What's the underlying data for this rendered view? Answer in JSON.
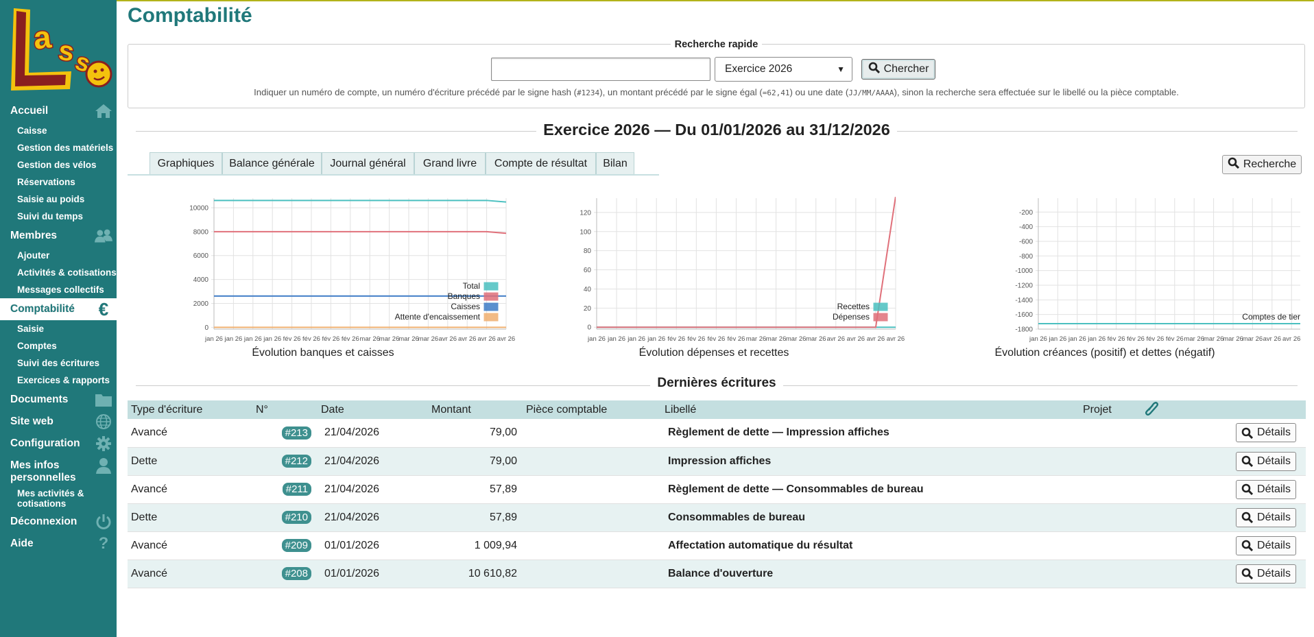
{
  "app": {
    "logo_text": "LASSO"
  },
  "sidebar": {
    "items": [
      {
        "label": "Accueil",
        "icon": "home-icon"
      },
      {
        "label": "Caisse"
      },
      {
        "label": "Gestion des matériels"
      },
      {
        "label": "Gestion des vélos"
      },
      {
        "label": "Réservations"
      },
      {
        "label": "Saisie au poids"
      },
      {
        "label": "Suivi du temps"
      },
      {
        "label": "Membres",
        "icon": "users-icon"
      },
      {
        "label": "Ajouter"
      },
      {
        "label": "Activités & cotisations"
      },
      {
        "label": "Messages collectifs"
      },
      {
        "label": "Comptabilité",
        "icon": "euro-icon",
        "active": true
      },
      {
        "label": "Saisie"
      },
      {
        "label": "Comptes"
      },
      {
        "label": "Suivi des écritures"
      },
      {
        "label": "Exercices & rapports"
      },
      {
        "label": "Documents",
        "icon": "folder-icon"
      },
      {
        "label": "Site web",
        "icon": "globe-icon"
      },
      {
        "label": "Configuration",
        "icon": "gear-icon"
      },
      {
        "label": "Mes infos personnelles",
        "icon": "user-icon"
      },
      {
        "label": "Mes activités & cotisations"
      },
      {
        "label": "Déconnexion",
        "icon": "power-icon"
      },
      {
        "label": "Aide",
        "icon": "question-icon"
      }
    ]
  },
  "page": {
    "title": "Comptabilité"
  },
  "quick_search": {
    "legend": "Recherche rapide",
    "input_value": "",
    "select_value": "Exercice 2026",
    "button_label": "Chercher",
    "help_parts": {
      "p1": "Indiquer un numéro de compte, un numéro d'écriture précédé par le signe hash (",
      "c1": "#1234",
      "p2": "), un montant précédé par le signe égal (",
      "c2": "=62,41",
      "p3": ") ou une date (",
      "c3": "JJ/MM/AAAA",
      "p4": "), sinon la recherche sera effectuée sur le libellé ou la pièce comptable."
    }
  },
  "exercise": {
    "title": "Exercice 2026 — Du 01/01/2026 au 31/12/2026"
  },
  "tabs": [
    {
      "label": "Graphiques"
    },
    {
      "label": "Balance générale"
    },
    {
      "label": "Journal général"
    },
    {
      "label": "Grand livre"
    },
    {
      "label": "Compte de résultat"
    },
    {
      "label": "Bilan"
    }
  ],
  "search_button": {
    "label": "Recherche"
  },
  "chart_data": [
    {
      "type": "line",
      "title": "Évolution banques et caisses",
      "x": [
        "jan 26",
        "jan 26",
        "jan 26",
        "jan 26",
        "fév 26",
        "fév 26",
        "fév 26",
        "fév 26",
        "mar 26",
        "mar 26",
        "mar 26",
        "mar 26",
        "avr 26",
        "avr 26",
        "avr 26",
        "avr 26"
      ],
      "yticks": [
        0,
        2000,
        4000,
        6000,
        8000,
        10000
      ],
      "ylim": [
        -150,
        10800
      ],
      "legend": "bottom-right",
      "grid": true,
      "series": [
        {
          "name": "Total",
          "color": "#4bc0c0",
          "values": [
            10610,
            10610,
            10610,
            10610,
            10610,
            10610,
            10610,
            10610,
            10610,
            10610,
            10610,
            10610,
            10610,
            10610,
            10610,
            10474
          ]
        },
        {
          "name": "Banques",
          "color": "#e0707a",
          "values": [
            7997,
            7997,
            7997,
            7997,
            7997,
            7997,
            7997,
            7997,
            7997,
            7997,
            7997,
            7997,
            7997,
            7997,
            7997,
            7861
          ]
        },
        {
          "name": "Caisses",
          "color": "#3e7cc6",
          "values": [
            2613,
            2613,
            2613,
            2613,
            2613,
            2613,
            2613,
            2613,
            2613,
            2613,
            2613,
            2613,
            2613,
            2613,
            2613,
            2613
          ]
        },
        {
          "name": "Attente d'encaissement",
          "color": "#f0b070",
          "values": [
            0,
            0,
            0,
            0,
            0,
            0,
            0,
            0,
            0,
            0,
            0,
            0,
            0,
            0,
            0,
            0
          ]
        }
      ]
    },
    {
      "type": "line",
      "title": "Évolution dépenses et recettes",
      "x": [
        "jan 26",
        "jan 26",
        "jan 26",
        "jan 26",
        "fév 26",
        "fév 26",
        "fév 26",
        "fév 26",
        "mar 26",
        "mar 26",
        "mar 26",
        "mar 26",
        "avr 26",
        "avr 26",
        "avr 26",
        "avr 26"
      ],
      "yticks": [
        0,
        20,
        40,
        60,
        80,
        100,
        120
      ],
      "ylim": [
        -2,
        135
      ],
      "legend": "bottom-right",
      "grid": true,
      "series": [
        {
          "name": "Recettes",
          "color": "#4bc0c0",
          "values": [
            0,
            0,
            0,
            0,
            0,
            0,
            0,
            0,
            0,
            0,
            0,
            0,
            0,
            0,
            0,
            0
          ]
        },
        {
          "name": "Dépenses",
          "color": "#e0707a",
          "values": [
            0,
            0,
            0,
            0,
            0,
            0,
            0,
            0,
            0,
            0,
            0,
            0,
            0,
            0,
            0,
            137
          ]
        }
      ]
    },
    {
      "type": "line",
      "title": "Évolution créances (positif) et dettes (négatif)",
      "x": [
        "jan 26",
        "jan 26",
        "jan 26",
        "jan 26",
        "fév 26",
        "fév 26",
        "fév 26",
        "fév 26",
        "mar 26",
        "mar 26",
        "mar 26",
        "mar 26",
        "avr 26",
        "avr 26",
        "avr 26",
        "avr 26"
      ],
      "yticks": [
        -1800,
        -1600,
        -1400,
        -1200,
        -1000,
        -800,
        -600,
        -400,
        -200
      ],
      "ylim": [
        -1800,
        -10
      ],
      "legend": "bottom-right",
      "grid": true,
      "series": [
        {
          "name": "Comptes de tiers",
          "color": "#4bc0c0",
          "values": [
            -1725,
            -1725,
            -1725,
            -1725,
            -1725,
            -1725,
            -1725,
            -1725,
            -1725,
            -1725,
            -1725,
            -1725,
            -1725,
            -1725,
            -1725,
            -1725
          ]
        }
      ]
    }
  ],
  "last_entries": {
    "title": "Dernières écritures",
    "headers": [
      "Type d'écriture",
      "N°",
      "Date",
      "Montant",
      "Pièce comptable",
      "Libellé",
      "Projet"
    ],
    "details_label": "Détails",
    "rows": [
      {
        "type": "Avancé",
        "num": "#213",
        "date": "21/04/2026",
        "amount": "79,00",
        "piece": "",
        "label": "Règlement de dette — Impression affiches",
        "project": ""
      },
      {
        "type": "Dette",
        "num": "#212",
        "date": "21/04/2026",
        "amount": "79,00",
        "piece": "",
        "label": "Impression affiches",
        "project": ""
      },
      {
        "type": "Avancé",
        "num": "#211",
        "date": "21/04/2026",
        "amount": "57,89",
        "piece": "",
        "label": "Règlement de dette — Consommables de bureau",
        "project": ""
      },
      {
        "type": "Dette",
        "num": "#210",
        "date": "21/04/2026",
        "amount": "57,89",
        "piece": "",
        "label": "Consommables de bureau",
        "project": ""
      },
      {
        "type": "Avancé",
        "num": "#209",
        "date": "01/01/2026",
        "amount": "1 009,94",
        "piece": "",
        "label": "Affectation automatique du résultat",
        "project": ""
      },
      {
        "type": "Avancé",
        "num": "#208",
        "date": "01/01/2026",
        "amount": "10 610,82",
        "piece": "",
        "label": "Balance d'ouverture",
        "project": ""
      }
    ]
  }
}
